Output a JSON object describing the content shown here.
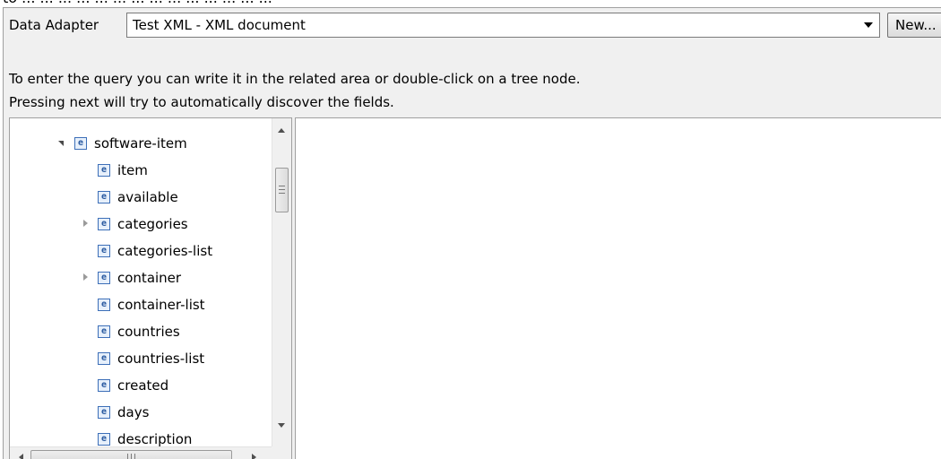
{
  "top_strip": {
    "text": "to ... ... ... ... ... ... ... ... ... ... ... ... ... ..."
  },
  "data_adapter": {
    "label": "Data Adapter",
    "selected": "Test XML - XML document",
    "new_button": "New..."
  },
  "hints": {
    "line1": "To enter the query you can write it in the related area or double-click on a tree node.",
    "line2": "Pressing next will try to automatically discover the fields."
  },
  "tree": {
    "icon_glyph": "e",
    "items": [
      {
        "label": "software-item",
        "twisty": "expanded"
      },
      {
        "label": "item",
        "twisty": "none"
      },
      {
        "label": "available",
        "twisty": "none"
      },
      {
        "label": "categories",
        "twisty": "collapsed"
      },
      {
        "label": "categories-list",
        "twisty": "none"
      },
      {
        "label": "container",
        "twisty": "collapsed"
      },
      {
        "label": "container-list",
        "twisty": "none"
      },
      {
        "label": "countries",
        "twisty": "none"
      },
      {
        "label": "countries-list",
        "twisty": "none"
      },
      {
        "label": "created",
        "twisty": "none"
      },
      {
        "label": "days",
        "twisty": "none"
      },
      {
        "label": "description",
        "twisty": "none"
      }
    ]
  },
  "query": {
    "text": ""
  },
  "colors": {
    "dialog_bg": "#f0f0f0",
    "icon_blue": "#3d6fb8"
  }
}
